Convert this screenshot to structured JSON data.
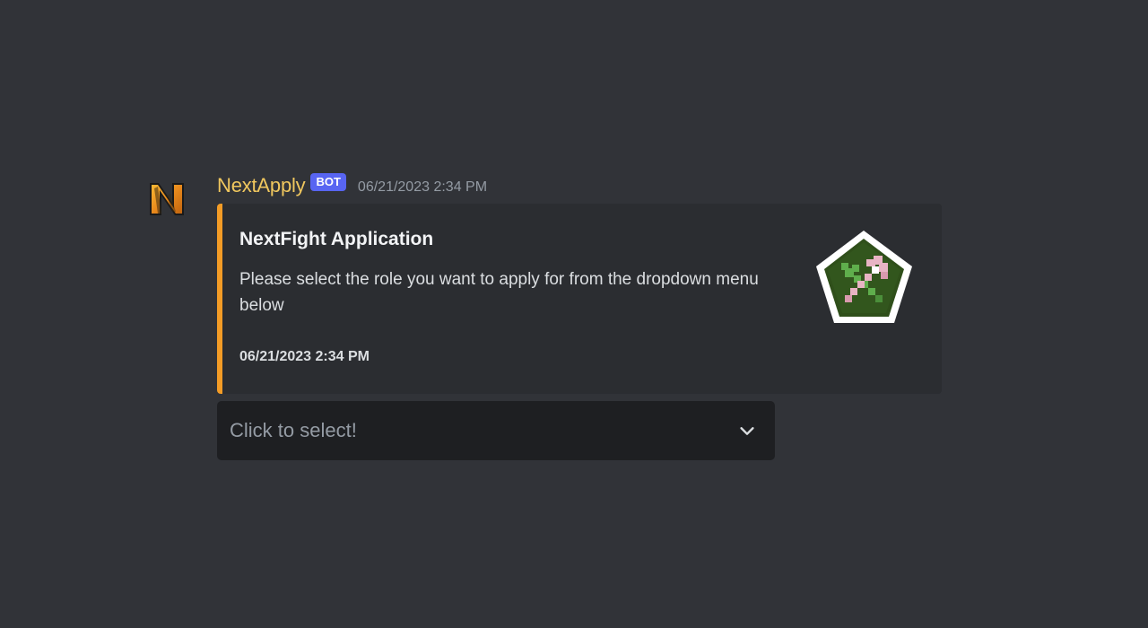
{
  "message": {
    "author": {
      "username": "NextApply",
      "tag": "BOT",
      "avatar_icon": "nextapply-logo-icon",
      "name_color": "#f0c75e"
    },
    "timestamp": "06/21/2023 2:34 PM",
    "embed": {
      "accent_color": "#f39c26",
      "title": "NextFight Application",
      "description": "Please select the role you want to apply for from the dropdown menu below",
      "footer_timestamp": "06/21/2023 2:34 PM",
      "thumbnail_icon": "crossed-tools-pentagon-icon"
    },
    "select_menu": {
      "placeholder": "Click to select!",
      "chevron_icon": "chevron-down-icon"
    }
  },
  "colors": {
    "background": "#313338",
    "embed_background": "#2b2d31",
    "select_background": "#1e1f22",
    "bot_tag": "#5865f2"
  }
}
